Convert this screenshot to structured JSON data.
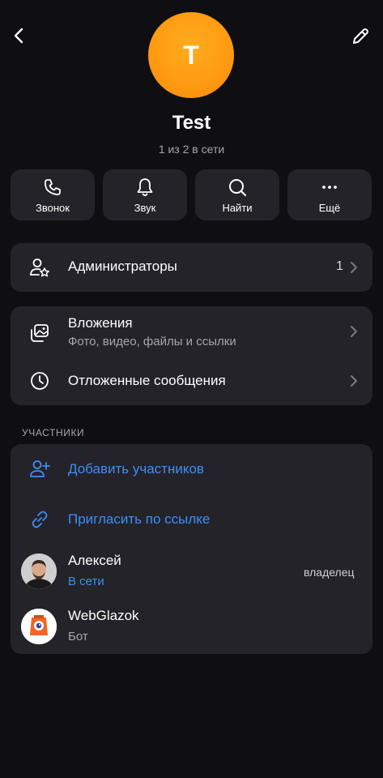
{
  "header": {
    "avatar_letter": "T",
    "title": "Test",
    "subtitle": "1 из 2 в сети"
  },
  "actions": [
    {
      "icon": "phone-icon",
      "label": "Звонок"
    },
    {
      "icon": "bell-icon",
      "label": "Звук"
    },
    {
      "icon": "search-icon",
      "label": "Найти"
    },
    {
      "icon": "more-icon",
      "label": "Ещё"
    }
  ],
  "admins": {
    "icon": "admin-user-star-icon",
    "title": "Администраторы",
    "count": "1"
  },
  "attachments": {
    "icon": "gallery-icon",
    "title": "Вложения",
    "subtitle": "Фото, видео, файлы и ссылки"
  },
  "scheduled": {
    "icon": "clock-icon",
    "title": "Отложенные сообщения"
  },
  "members_section": {
    "label": "УЧАСТНИКИ",
    "add_members": {
      "icon": "add-user-icon",
      "label": "Добавить участников"
    },
    "invite_link": {
      "icon": "link-icon",
      "label": "Пригласить по ссылке"
    },
    "members": [
      {
        "name": "Алексей",
        "status": "В сети",
        "role": "владелец"
      },
      {
        "name": "WebGlazok",
        "status": "Бот"
      }
    ]
  },
  "colors": {
    "background": "#0f0f13",
    "card": "#232329",
    "accent_blue": "#3d8ef7",
    "avatar_orange": "#ff9c12",
    "secondary_text": "#a6a6ad"
  }
}
